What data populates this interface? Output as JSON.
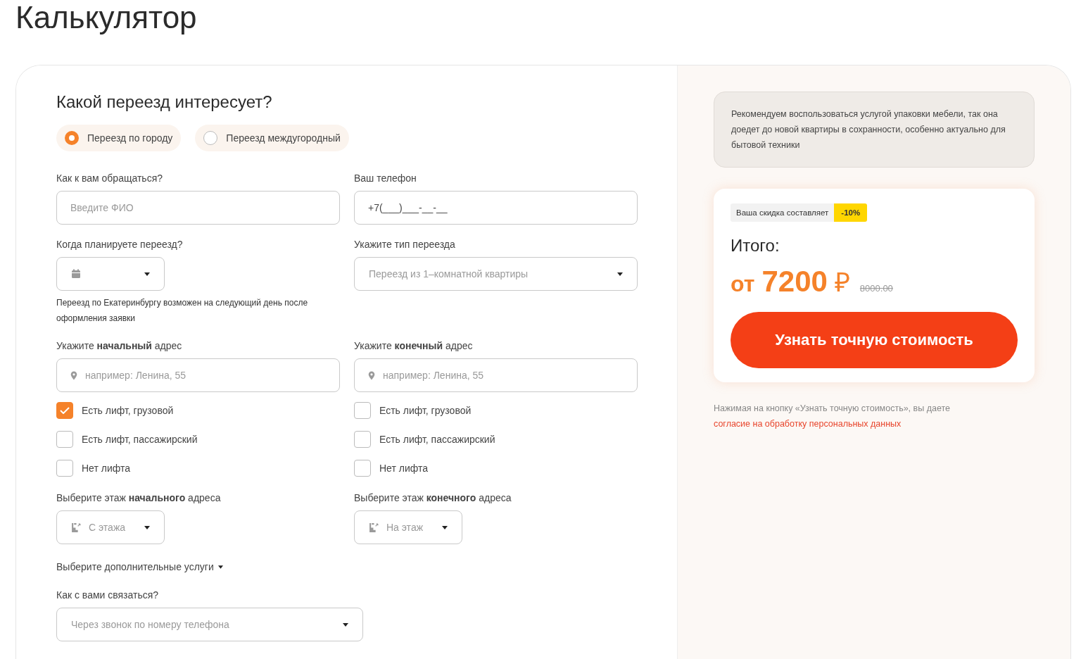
{
  "page_title": "Калькулятор",
  "form": {
    "heading": "Какой переезд интересует?",
    "move_types": [
      {
        "label": "Переезд по городу",
        "selected": true
      },
      {
        "label": "Переезд междугородный",
        "selected": false
      }
    ],
    "name_field": {
      "label": "Как к вам обращаться?",
      "placeholder": "Введите ФИО"
    },
    "phone_field": {
      "label": "Ваш телефон",
      "value": "+7(___)___-__-__"
    },
    "date_field": {
      "label": "Когда планируете переезд?",
      "note": "Переезд по Екатеринбургу возможен на следующий день после оформления заявки"
    },
    "move_type_select": {
      "label": "Укажите тип переезда",
      "placeholder": "Переезд из 1–комнатной квартиры"
    },
    "addresses": [
      {
        "label": "Укажите **начальный** адрес",
        "placeholder": "например: Ленина, 55",
        "lift_options": [
          {
            "label": "Есть лифт, грузовой",
            "checked": true
          },
          {
            "label": "Есть лифт, пассажирский",
            "checked": false
          },
          {
            "label": "Нет лифта",
            "checked": false
          }
        ],
        "floor_label": "Выберите этаж **начального** адреса",
        "floor_placeholder": "С этажа"
      },
      {
        "label": "Укажите **конечный** адрес",
        "placeholder": "например: Ленина, 55",
        "lift_options": [
          {
            "label": "Есть лифт, грузовой",
            "checked": false
          },
          {
            "label": "Есть лифт, пассажирский",
            "checked": false
          },
          {
            "label": "Нет лифта",
            "checked": false
          }
        ],
        "floor_label": "Выберите этаж **конечного** адреса",
        "floor_placeholder": "На этаж"
      }
    ],
    "extra_services": "Выберите дополнительные услуги",
    "contact_select": {
      "label": "Как с вами связаться?",
      "placeholder": "Через звонок по номеру телефона"
    }
  },
  "sidebar": {
    "tip": "Рекомендуем воспользоваться услугой упаковки мебели, так она доедет до новой квартиры в сохранности, особенно актуально для бытовой техники",
    "discount_label": "Ваша скидка составляет",
    "discount": "-10%",
    "total_label": "Итого:",
    "price_prefix": "от",
    "price": "7200",
    "currency": "₽",
    "old_price": "8000.00",
    "button": "Узнать точную стоимость",
    "consent_text": "Нажимая на кнопку «Узнать точную стоимость», вы даете",
    "consent_link": "согласие на обработку персональных данных"
  }
}
